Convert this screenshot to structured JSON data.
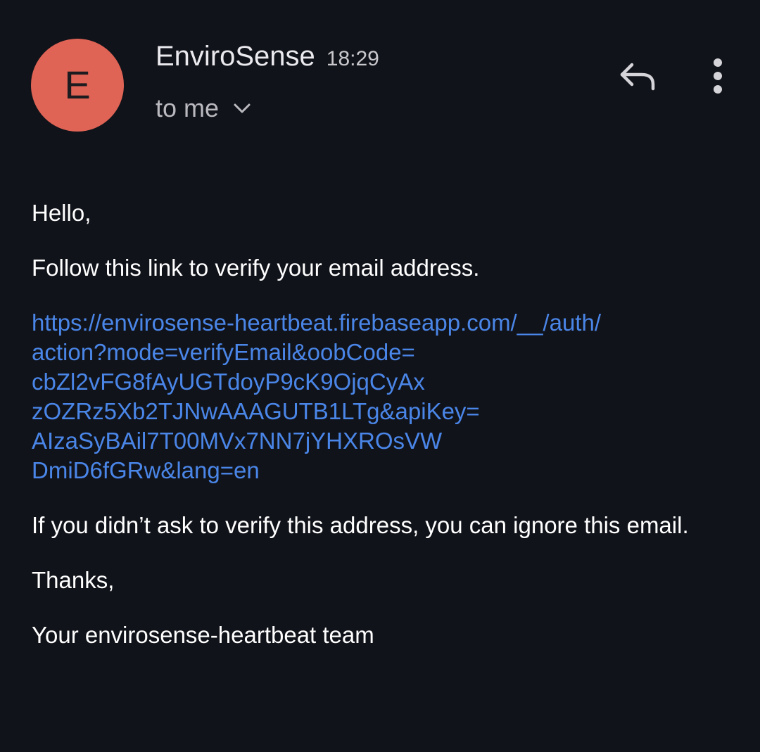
{
  "header": {
    "avatar_letter": "E",
    "sender_name": "EnviroSense",
    "time": "18:29",
    "recipient": "to me",
    "avatar_color": "#e06455"
  },
  "actions": {
    "reply_icon": "reply-icon",
    "more_icon": "more-vert-icon"
  },
  "message": {
    "greeting": "Hello,",
    "instruction": "Follow this link to verify your email address.",
    "link_lines": [
      "https://envirosense-heartbeat.firebaseapp.com/__/auth/",
      "action?mode=verifyEmail&oobCode=",
      "cbZl2vFG8fAyUGTdoyP9cK9OjqCyAx",
      "zOZRz5Xb2TJNwAAAGUTB1LTg&apiKey=",
      "AIzaSyBAil7T00MVx7NN7jYHXROsVW",
      "DmiD6fGRw&lang=en"
    ],
    "disclaimer": "If you didn’t ask to verify this address, you can ignore this email.",
    "thanks": "Thanks,",
    "signature": "Your envirosense-heartbeat team"
  },
  "colors": {
    "background": "#11131a",
    "link": "#4a86e8"
  }
}
